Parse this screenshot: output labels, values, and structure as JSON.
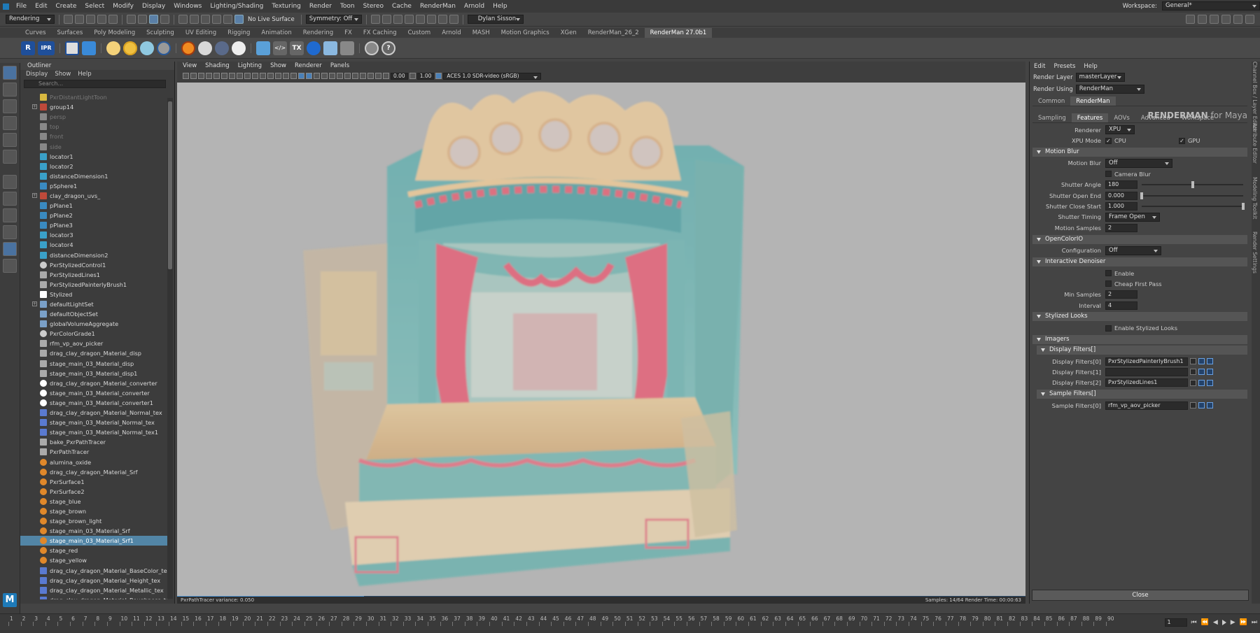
{
  "menubar": {
    "items": [
      "File",
      "Edit",
      "Create",
      "Select",
      "Modify",
      "Display",
      "Windows",
      "Lighting/Shading",
      "Texturing",
      "Render",
      "Toon",
      "Stereo",
      "Cache",
      "RenderMan",
      "Arnold",
      "Help"
    ],
    "workspace_label": "Workspace:",
    "workspace_value": "General*"
  },
  "toolbar": {
    "mode": "Rendering",
    "live_surface": "No Live Surface",
    "symmetry": "Symmetry: Off",
    "user": "Dylan Sisson"
  },
  "shelf": {
    "tabs": [
      "Curves",
      "Surfaces",
      "Poly Modeling",
      "Sculpting",
      "UV Editing",
      "Rigging",
      "Animation",
      "Rendering",
      "FX",
      "FX Caching",
      "Custom",
      "Arnold",
      "MASH",
      "Motion Graphics",
      "XGen",
      "RenderMan_26_2",
      "RenderMan 27.0b1"
    ],
    "active_tab": "RenderMan 27.0b1",
    "ipr_label": "IPR"
  },
  "outliner": {
    "title": "Outliner",
    "menu": [
      "Display",
      "Show",
      "Help"
    ],
    "search_placeholder": "Search...",
    "items": [
      {
        "label": "PxrDistantLightToon",
        "icon": "light-icon",
        "dim": true
      },
      {
        "label": "group14",
        "icon": "group-icon",
        "expand": true
      },
      {
        "label": "persp",
        "icon": "camera-icon",
        "dim": true
      },
      {
        "label": "top",
        "icon": "camera-icon",
        "dim": true
      },
      {
        "label": "front",
        "icon": "camera-icon",
        "dim": true
      },
      {
        "label": "side",
        "icon": "camera-icon",
        "dim": true
      },
      {
        "label": "locator1",
        "icon": "locator-icon"
      },
      {
        "label": "locator2",
        "icon": "locator-icon"
      },
      {
        "label": "distanceDimension1",
        "icon": "locator-icon"
      },
      {
        "label": "pSphere1",
        "icon": "mesh-icon"
      },
      {
        "label": "clay_dragon_uvs_",
        "icon": "group-icon",
        "expand": true
      },
      {
        "label": "pPlane1",
        "icon": "mesh-icon"
      },
      {
        "label": "pPlane2",
        "icon": "mesh-icon"
      },
      {
        "label": "pPlane3",
        "icon": "mesh-icon"
      },
      {
        "label": "locator3",
        "icon": "locator-icon"
      },
      {
        "label": "locator4",
        "icon": "locator-icon"
      },
      {
        "label": "distanceDimension2",
        "icon": "locator-icon"
      },
      {
        "label": "PxrStylizedControl1",
        "icon": "sphere-icon"
      },
      {
        "label": "PxrStylizedLines1",
        "icon": "node-icon"
      },
      {
        "label": "PxrStylizedPainterlyBrush1",
        "icon": "node-icon"
      },
      {
        "label": "Stylized",
        "icon": "r-icon"
      },
      {
        "label": "defaultLightSet",
        "icon": "set-icon",
        "expand": true
      },
      {
        "label": "defaultObjectSet",
        "icon": "set-icon"
      },
      {
        "label": "globalVolumeAggregate",
        "icon": "set-icon"
      },
      {
        "label": "PxrColorGrade1",
        "icon": "sphere-icon"
      },
      {
        "label": "rfm_vp_aov_picker",
        "icon": "node-icon"
      },
      {
        "label": "drag_clay_dragon_Material_disp",
        "icon": "node-icon"
      },
      {
        "label": "stage_main_03_Material_disp",
        "icon": "node-icon"
      },
      {
        "label": "stage_main_03_Material_disp1",
        "icon": "node-icon"
      },
      {
        "label": "drag_clay_dragon_Material_converter",
        "icon": "star-icon"
      },
      {
        "label": "stage_main_03_Material_converter",
        "icon": "star-icon"
      },
      {
        "label": "stage_main_03_Material_converter1",
        "icon": "star-icon"
      },
      {
        "label": "drag_clay_dragon_Material_Normal_tex",
        "icon": "texture-icon"
      },
      {
        "label": "stage_main_03_Material_Normal_tex",
        "icon": "texture-icon"
      },
      {
        "label": "stage_main_03_Material_Normal_tex1",
        "icon": "texture-icon"
      },
      {
        "label": "bake_PxrPathTracer",
        "icon": "node-icon"
      },
      {
        "label": "PxrPathTracer",
        "icon": "node-icon"
      },
      {
        "label": "alumina_oxide",
        "icon": "material-icon"
      },
      {
        "label": "drag_clay_dragon_Material_Srf",
        "icon": "material-icon"
      },
      {
        "label": "PxrSurface1",
        "icon": "material-icon"
      },
      {
        "label": "PxrSurface2",
        "icon": "material-icon"
      },
      {
        "label": "stage_blue",
        "icon": "material-icon"
      },
      {
        "label": "stage_brown",
        "icon": "material-icon"
      },
      {
        "label": "stage_brown_light",
        "icon": "material-icon"
      },
      {
        "label": "stage_main_03_Material_Srf",
        "icon": "material-icon"
      },
      {
        "label": "stage_main_03_Material_Srf1",
        "icon": "material-icon",
        "selected": true
      },
      {
        "label": "stage_red",
        "icon": "material-icon"
      },
      {
        "label": "stage_yellow",
        "icon": "material-icon"
      },
      {
        "label": "drag_clay_dragon_Material_BaseColor_tex",
        "icon": "texture-icon"
      },
      {
        "label": "drag_clay_dragon_Material_Height_tex",
        "icon": "texture-icon"
      },
      {
        "label": "drag_clay_dragon_Material_Metallic_tex",
        "icon": "texture-icon"
      },
      {
        "label": "drag_clay_dragon_Material_Roughness_tex",
        "icon": "texture-icon"
      }
    ]
  },
  "viewport": {
    "menu": [
      "View",
      "Shading",
      "Lighting",
      "Show",
      "Renderer",
      "Panels"
    ],
    "field_a": "0.00",
    "field_b": "1.00",
    "colorspace": "ACES 1.0 SDR-video (sRGB)",
    "status_left": "PxrPathTracer  variance: 0.050",
    "status_right": "Samples: 14/64   Render Time: 00:00:63",
    "progress_fraction": 0.22
  },
  "render_settings": {
    "menu": [
      "Edit",
      "Presets",
      "Help"
    ],
    "render_layer_label": "Render Layer",
    "render_layer": "masterLayer",
    "render_using_label": "Render Using",
    "render_using": "RenderMan",
    "top_tabs": [
      "Common",
      "RenderMan"
    ],
    "active_top_tab": "RenderMan",
    "logo_main": "RENDERMAN",
    "logo_sub": " for Maya",
    "tabs": [
      "Sampling",
      "Features",
      "AOVs",
      "Advanced",
      "Workspace"
    ],
    "active_tab": "Features",
    "renderer_label": "Renderer",
    "renderer": "XPU",
    "xpu_mode_label": "XPU Mode",
    "cpu_label": "CPU",
    "gpu_label": "GPU",
    "motion_blur": {
      "title": "Motion Blur",
      "motion_blur_label": "Motion Blur",
      "motion_blur": "Off",
      "camera_blur_label": "Camera Blur",
      "shutter_angle_label": "Shutter Angle",
      "shutter_angle": "180",
      "shutter_angle_frac": 0.5,
      "shutter_open_end_label": "Shutter Open End",
      "shutter_open_end": "0.000",
      "shutter_open_end_frac": 0.0,
      "shutter_close_start_label": "Shutter Close Start",
      "shutter_close_start": "1.000",
      "shutter_close_start_frac": 1.0,
      "shutter_timing_label": "Shutter Timing",
      "shutter_timing": "Frame Open",
      "motion_samples_label": "Motion Samples",
      "motion_samples": "2"
    },
    "ocio": {
      "title": "OpenColorIO",
      "configuration_label": "Configuration",
      "configuration": "Off"
    },
    "denoiser": {
      "title": "Interactive Denoiser",
      "enable_label": "Enable",
      "cheap_label": "Cheap First Pass",
      "min_samples_label": "Min Samples",
      "min_samples": "2",
      "interval_label": "Interval",
      "interval": "4"
    },
    "stylized": {
      "title": "Stylized Looks",
      "enable_label": "Enable Stylized Looks"
    },
    "imagers_title": "Imagers",
    "display_filters": {
      "title": "Display Filters[]",
      "rows": [
        {
          "label": "Display Filters[0]",
          "value": "PxrStylizedPainterlyBrush1"
        },
        {
          "label": "Display Filters[1]",
          "value": ""
        },
        {
          "label": "Display Filters[2]",
          "value": "PxrStylizedLines1"
        }
      ]
    },
    "sample_filters": {
      "title": "Sample Filters[]",
      "rows": [
        {
          "label": "Sample Filters[0]",
          "value": "rfm_vp_aov_picker"
        }
      ]
    },
    "close_label": "Close"
  },
  "side_tabs": [
    "Channel Box / Layer Editor",
    "Attribute Editor",
    "Modeling Toolkit",
    "Render Settings"
  ],
  "timeline": {
    "start": 1,
    "end": 90,
    "current_frame": "1"
  },
  "maya_logo": "M"
}
